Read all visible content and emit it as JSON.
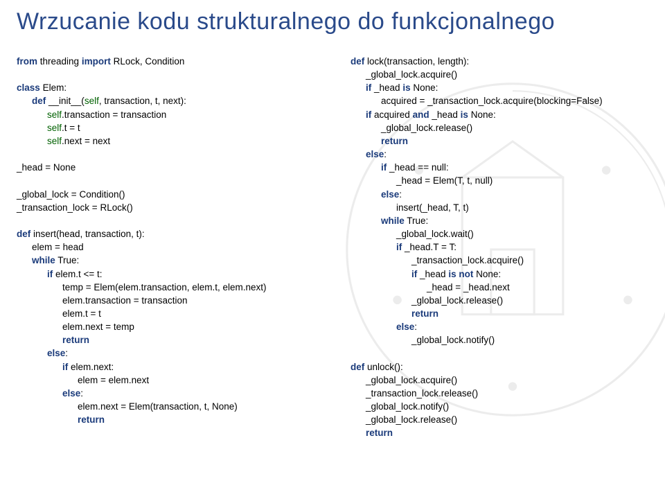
{
  "title": "Wrzucanie kodu strukturalnego do funkcjonalnego",
  "left": {
    "l1a": "from",
    "l1b": "threading",
    "l1c": "import",
    "l1d": "RLock, Condition",
    "l2a": "class",
    "l2b": "Elem:",
    "l3a": "def",
    "l3b": "__init__(",
    "l3c": "self",
    "l3d": ", transaction, t, next):",
    "l4a": "self",
    "l4b": ".transaction = transaction",
    "l5a": "self",
    "l5b": ".t = t",
    "l6a": "self",
    "l6b": ".next = next",
    "l7": "_head = None",
    "l8": "_global_lock = Condition()",
    "l9": "_transaction_lock = RLock()",
    "l10a": "def",
    "l10b": "insert(head, transaction, t):",
    "l11": "elem = head",
    "l12a": "while",
    "l12b": "True:",
    "l13a": "if",
    "l13b": "elem.t <= t:",
    "l14": "temp = Elem(elem.transaction, elem.t, elem.next)",
    "l15": "elem.transaction = transaction",
    "l16": "elem.t = t",
    "l17": "elem.next = temp",
    "l18": "return",
    "l19a": "else",
    "l19b": ":",
    "l20a": "if",
    "l20b": "elem.next:",
    "l21": "elem = elem.next",
    "l22a": "else",
    "l22b": ":",
    "l23": "elem.next = Elem(transaction, t, None)",
    "l24": "return"
  },
  "right": {
    "r1a": "def",
    "r1b": "lock(transaction, length):",
    "r2": "_global_lock.acquire()",
    "r3a": "if",
    "r3b": "_head",
    "r3c": "is",
    "r3d": "None:",
    "r4": "acquired = _transaction_lock.acquire(blocking=False)",
    "r5a": "if",
    "r5b": "acquired",
    "r5c": "and",
    "r5d": "_head",
    "r5e": "is",
    "r5f": "None:",
    "r6": "_global_lock.release()",
    "r7": "return",
    "r8a": "else",
    "r8b": ":",
    "r9a": "if",
    "r9b": "_head == null:",
    "r10": "_head = Elem(T, t, null)",
    "r11a": "else",
    "r11b": ":",
    "r12": "insert(_head, T, t)",
    "r13a": "while",
    "r13b": "True:",
    "r14": "_global_lock.wait()",
    "r15a": "if",
    "r15b": "_head.T = T:",
    "r16": "_transaction_lock.acquire()",
    "r17a": "if",
    "r17b": "_head",
    "r17c": "is not",
    "r17d": "None:",
    "r18": "_head = _head.next",
    "r19": "_global_lock.release()",
    "r20": "return",
    "r21a": "else",
    "r21b": ":",
    "r22": "_global_lock.notify()",
    "r23a": "def",
    "r23b": "unlock():",
    "r24": "_global_lock.acquire()",
    "r25": "_transaction_lock.release()",
    "r26": "_global_lock.notify()",
    "r27": "_global_lock.release()",
    "r28": "return"
  }
}
